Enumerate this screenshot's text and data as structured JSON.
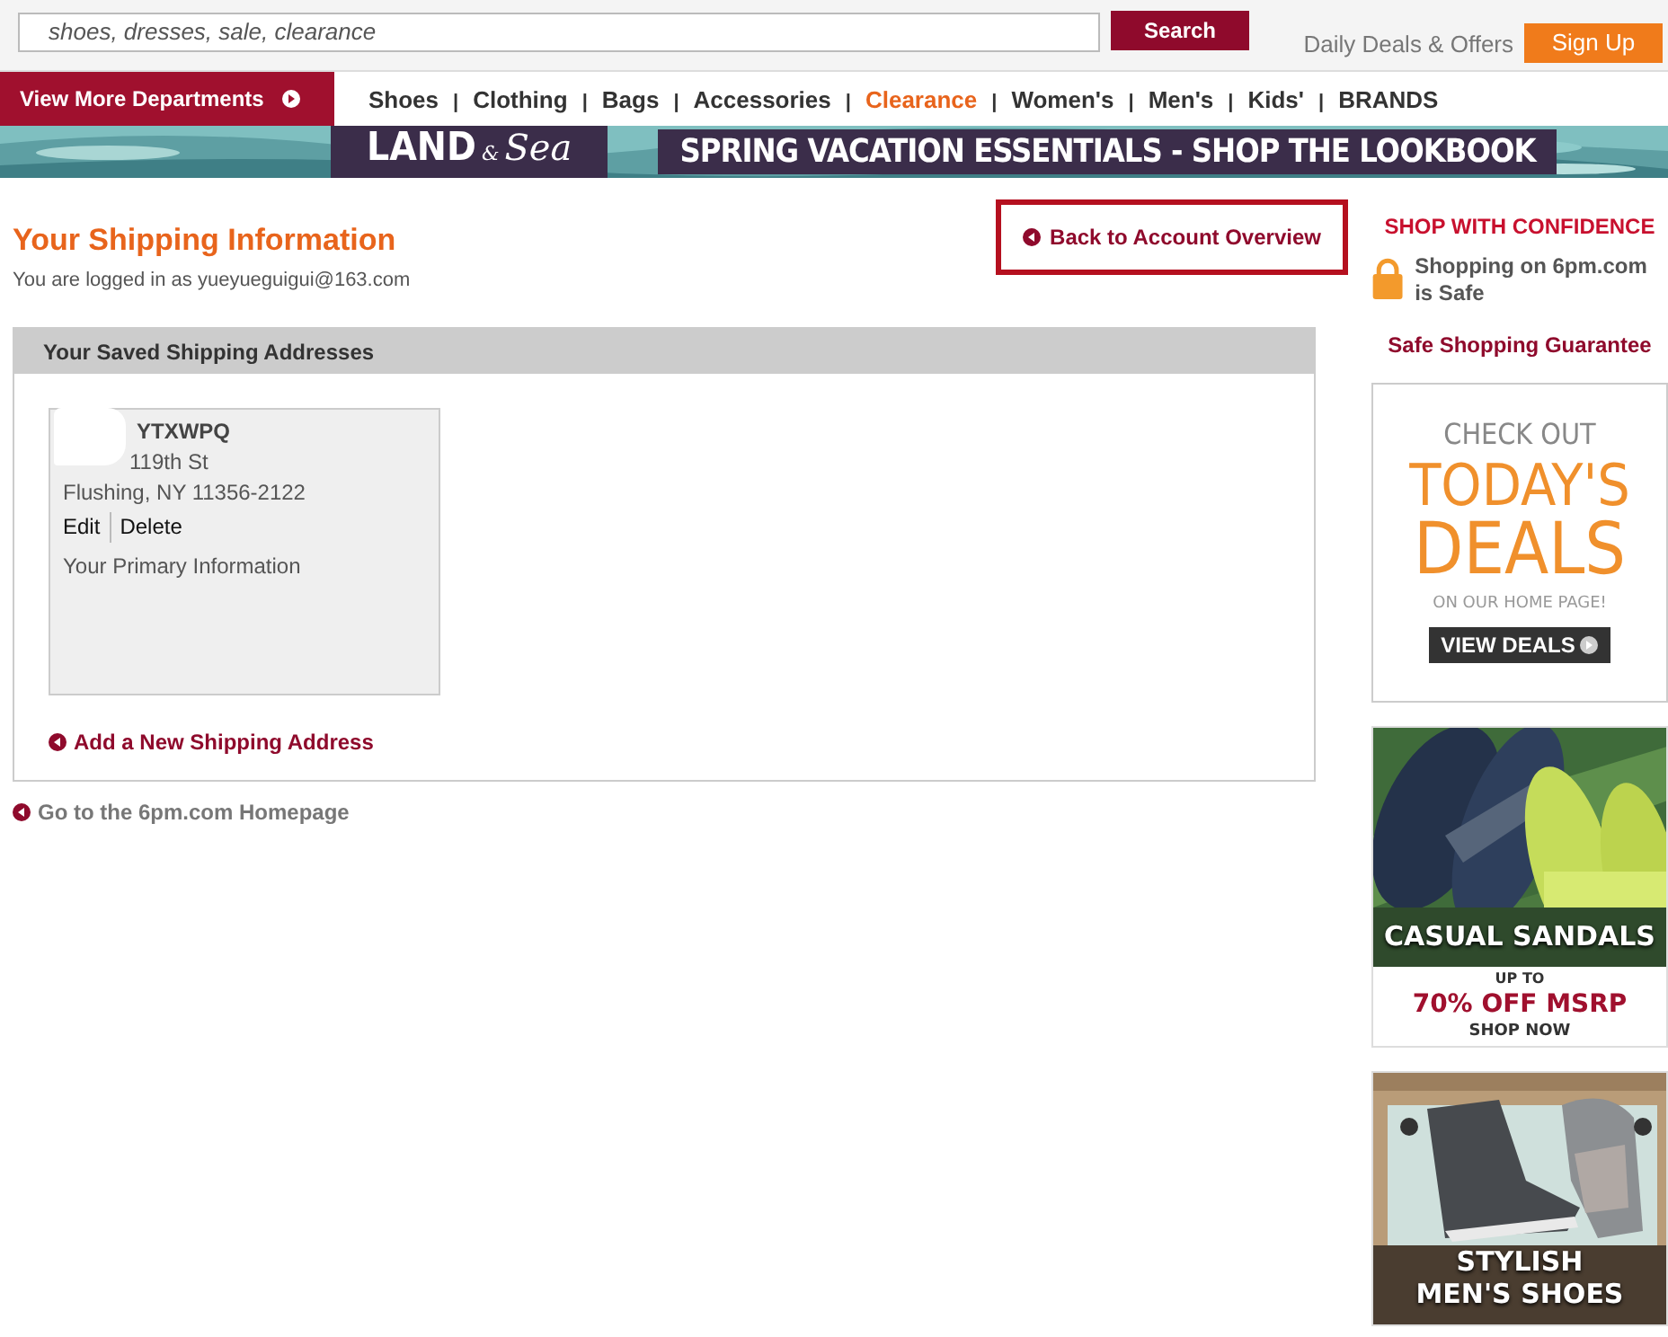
{
  "search": {
    "placeholder": "shoes, dresses, sale, clearance",
    "button": "Search"
  },
  "header_links": {
    "deals": "Daily Deals & Offers",
    "sign_up": "Sign Up"
  },
  "departments_button": "View More Departments",
  "nav": [
    {
      "label": "Shoes",
      "highlight": false
    },
    {
      "label": "Clothing",
      "highlight": false
    },
    {
      "label": "Bags",
      "highlight": false
    },
    {
      "label": "Accessories",
      "highlight": false
    },
    {
      "label": "Clearance",
      "highlight": true
    },
    {
      "label": "Women's",
      "highlight": false
    },
    {
      "label": "Men's",
      "highlight": false
    },
    {
      "label": "Kids'",
      "highlight": false
    },
    {
      "label": "BRANDS",
      "highlight": false
    }
  ],
  "nav_separator": "|",
  "banner": {
    "logo_main": "LAND",
    "logo_amp": "&",
    "logo_script": "Sea",
    "headline": "SPRING VACATION ESSENTIALS - SHOP THE LOOKBOOK"
  },
  "page": {
    "title": "Your Shipping Information",
    "logged_in": "You are logged in as yueyueguigui@163.com",
    "back_link": "Back to Account Overview"
  },
  "addresses_panel": {
    "heading": "Your Saved Shipping Addresses",
    "addresses": [
      {
        "name": "YTXWPQ",
        "street": "119th St",
        "city": "Flushing, NY 11356-2122",
        "actions": [
          "Edit",
          "Delete"
        ],
        "note": "Your Primary Information"
      }
    ],
    "add_link": "Add a New Shipping Address"
  },
  "home_link": "Go to the 6pm.com Homepage",
  "sidebar": {
    "confidence_title": "SHOP WITH CONFIDENCE",
    "safe_text": "Shopping on 6pm.com is Safe",
    "guarantee_link": "Safe Shopping Guarantee",
    "deals_ad": {
      "kicker": "CHECK OUT",
      "headline_1": "TODAY'S",
      "headline_2": "DEALS",
      "sub": "ON OUR HOME PAGE!",
      "button": "VIEW DEALS"
    },
    "promos": [
      {
        "kind": "sandals",
        "overlay": "CASUAL SANDALS",
        "up_to": "UP TO",
        "offer": "70% OFF MSRP",
        "cta": "SHOP NOW"
      },
      {
        "kind": "sneakers",
        "overlay_1": "STYLISH",
        "overlay_2": "MEN'S SHOES"
      }
    ]
  }
}
